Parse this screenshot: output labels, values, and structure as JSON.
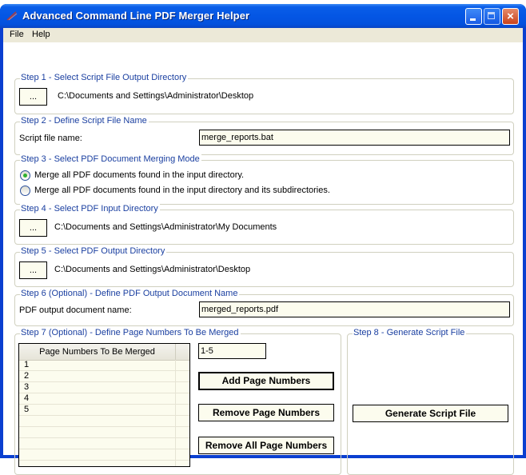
{
  "window": {
    "title": "Advanced Command Line PDF Merger Helper",
    "controls": {
      "minimize": "minimize",
      "maximize": "maximize",
      "close": "×"
    }
  },
  "menu": {
    "items": [
      "File",
      "Help"
    ]
  },
  "step1": {
    "legend": "Step 1 - Select Script File Output Directory",
    "browse_label": "...",
    "path": "C:\\Documents and Settings\\Administrator\\Desktop"
  },
  "step2": {
    "legend": "Step 2 - Define Script File Name",
    "label": "Script file name:",
    "value": "merge_reports.bat"
  },
  "step3": {
    "legend": "Step 3 - Select PDF Document Merging Mode",
    "options": [
      {
        "label": "Merge all PDF documents found in the input directory.",
        "checked": true
      },
      {
        "label": "Merge all PDF documents found in the input directory and its subdirectories.",
        "checked": false
      }
    ]
  },
  "step4": {
    "legend": "Step 4 - Select PDF Input Directory",
    "browse_label": "...",
    "path": "C:\\Documents and Settings\\Administrator\\My Documents"
  },
  "step5": {
    "legend": "Step 5 - Select PDF Output Directory",
    "browse_label": "...",
    "path": "C:\\Documents and Settings\\Administrator\\Desktop"
  },
  "step6": {
    "legend": "Step 6 (Optional) - Define PDF Output Document Name",
    "label": "PDF output document name:",
    "value": "merged_reports.pdf"
  },
  "step7": {
    "legend": "Step 7 (Optional) - Define Page Numbers To Be Merged",
    "list_header": "Page Numbers To Be Merged",
    "rows": [
      "1",
      "2",
      "3",
      "4",
      "5",
      "",
      "",
      "",
      ""
    ],
    "page_input": "1-5",
    "add_label": "Add Page Numbers",
    "remove_label": "Remove Page Numbers",
    "remove_all_label": "Remove All Page Numbers"
  },
  "step8": {
    "legend": "Step 8 - Generate Script File",
    "generate_label": "Generate Script File"
  }
}
